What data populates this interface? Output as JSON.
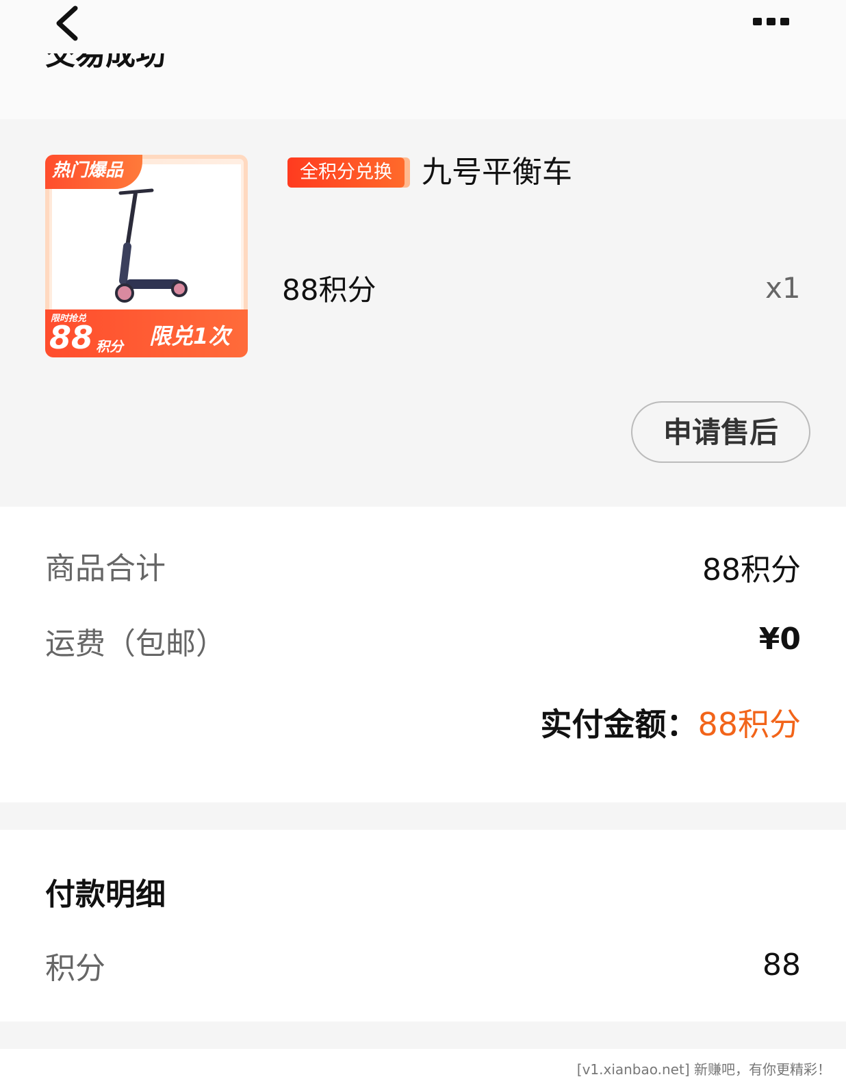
{
  "header": {
    "status_title": "交易成功",
    "back_icon": "chevron-left-icon",
    "more_icon": "more-dots-icon"
  },
  "product": {
    "image": {
      "hot_tag": "热门爆品",
      "limit_label": "限时抢兑",
      "price": "88",
      "price_unit": "积分",
      "limit_once": "限兑1次"
    },
    "exchange_tag": "全积分兑换",
    "name": "九号平衡车",
    "price": "88积分",
    "quantity": "x1",
    "after_sale_label": "申请售后"
  },
  "summary": {
    "subtotal_label": "商品合计",
    "subtotal_value": "88积分",
    "shipping_label": "运费（包邮）",
    "shipping_value": "¥0",
    "paid_label": "实付金额：",
    "paid_value": "88积分"
  },
  "payment": {
    "title": "付款明细",
    "points_label": "积分",
    "points_value": "88"
  },
  "footer": {
    "watermark": "[v1.xianbao.net] 新赚吧，有你更精彩！"
  },
  "colors": {
    "accent": "#f26419",
    "tag_red": "#ff3b1f"
  }
}
